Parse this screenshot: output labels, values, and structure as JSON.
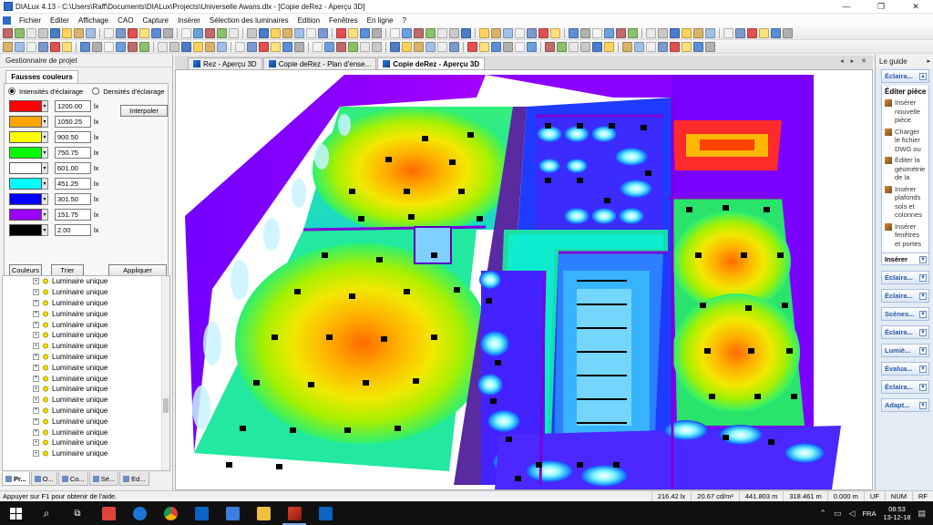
{
  "window": {
    "title": "DIALux 4.13 - C:\\Users\\Raff\\Documents\\DIALux\\Projects\\Universelle Awans.dlx - [Copie deRez - Aperçu 3D]",
    "minimize": "—",
    "maximize": "❐",
    "close": "✕"
  },
  "menu": [
    "Fichier",
    "Editer",
    "Affichage",
    "CAO",
    "Capture",
    "Insérer",
    "Sélection des luminaires",
    "Edition",
    "Fenêtres",
    "En ligne",
    "?"
  ],
  "left_panel": {
    "header": "Gestionnaire de projet",
    "tab_title": "Fausses couleurs",
    "radio_intensities": "Intensités d'éclairage",
    "radio_densities": "Densités d'éclairage",
    "interpolate_button": "Interpoler",
    "colors_button": "Couleurs",
    "sort_button": "Trier",
    "apply_button": "Appliquer",
    "unit": "lx",
    "legend": [
      {
        "color": "#ff0000",
        "value": "1200.00"
      },
      {
        "color": "#ffa500",
        "value": "1050.25"
      },
      {
        "color": "#ffff00",
        "value": "900.50"
      },
      {
        "color": "#00ff00",
        "value": "750.75"
      },
      {
        "color": "#ffffff",
        "value": "601.00"
      },
      {
        "color": "#00ffff",
        "value": "451.25"
      },
      {
        "color": "#0000ff",
        "value": "301.50"
      },
      {
        "color": "#9b00ff",
        "value": "151.75"
      },
      {
        "color": "#000000",
        "value": "2.00"
      }
    ],
    "tree_label": "Luminaire unique",
    "tree_count": 17,
    "bottom_tabs": [
      "Pr...",
      "O...",
      "Co...",
      "Sé...",
      "Ed..."
    ]
  },
  "doc_tabs": [
    "Rez - Aperçu 3D",
    "Copie deRez - Plan d'ense...",
    "Copie deRez - Aperçu 3D"
  ],
  "doc_controls": "◂ ▸ ✕",
  "guide": {
    "title": "Le guide",
    "close": "▸",
    "section_open": "Éclaira...",
    "body_title": "Éditer pièce",
    "items": [
      "Insérer nouvelle pièce",
      "Charger le fichier DWG ou",
      "Éditer la géométrie de la",
      "Insérer plafonds sols et colonnes",
      "Insérer fenêtres et portes"
    ],
    "insert_label": "Insérer",
    "sections": [
      "Éclaira...",
      "Éclaira...",
      "Scènes...",
      "Éclaira...",
      "Lumiè...",
      "Évalua...",
      "Éclaira...",
      "Adapt..."
    ]
  },
  "status": {
    "hint": "Appuyer sur F1 pour obtenir de l'aide.",
    "lux": "216.42 lx",
    "luminance": "20.67 cd/m²",
    "coord_x": "441.803 m",
    "coord_y": "318.461 m",
    "coord_z": "0.000 m",
    "uf": "UF",
    "num": "NUM",
    "rf": "RF"
  },
  "taskbar": {
    "lang": "FRA",
    "time": "08:53",
    "date": "13-12-18"
  },
  "colors": {
    "accent": "#2b6cc4",
    "guide_text": "#2a5aa8"
  }
}
